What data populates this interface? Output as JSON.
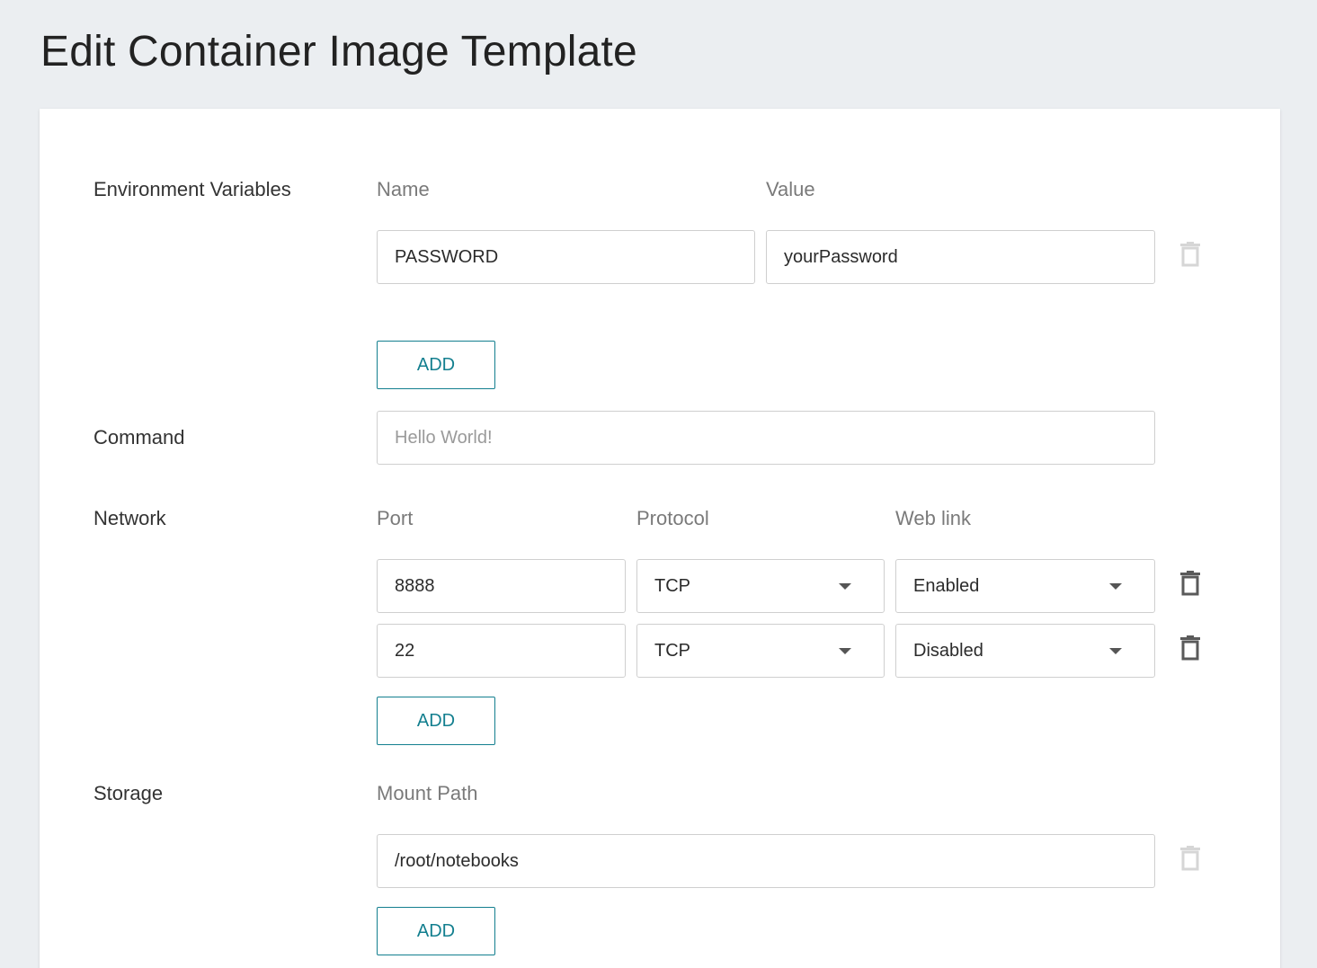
{
  "page": {
    "title": "Edit Container Image Template"
  },
  "env": {
    "label": "Environment Variables",
    "col_name": "Name",
    "col_value": "Value",
    "rows": [
      {
        "name": "PASSWORD",
        "value": "yourPassword",
        "delete_disabled": true
      }
    ],
    "add_label": "ADD"
  },
  "command": {
    "label": "Command",
    "placeholder": "Hello World!",
    "value": ""
  },
  "network": {
    "label": "Network",
    "col_port": "Port",
    "col_protocol": "Protocol",
    "col_weblink": "Web link",
    "rows": [
      {
        "port": "8888",
        "protocol": "TCP",
        "weblink": "Enabled"
      },
      {
        "port": "22",
        "protocol": "TCP",
        "weblink": "Disabled"
      }
    ],
    "add_label": "ADD"
  },
  "storage": {
    "label": "Storage",
    "col_mount": "Mount Path",
    "rows": [
      {
        "path": "/root/notebooks",
        "delete_disabled": true
      }
    ],
    "add_label": "ADD"
  },
  "colors": {
    "accent": "#137f8f",
    "trash_active": "#5a5a5a",
    "trash_disabled": "#d6d6d6"
  },
  "icons": {
    "delete": "trash-icon",
    "dropdown": "caret-down-icon"
  }
}
